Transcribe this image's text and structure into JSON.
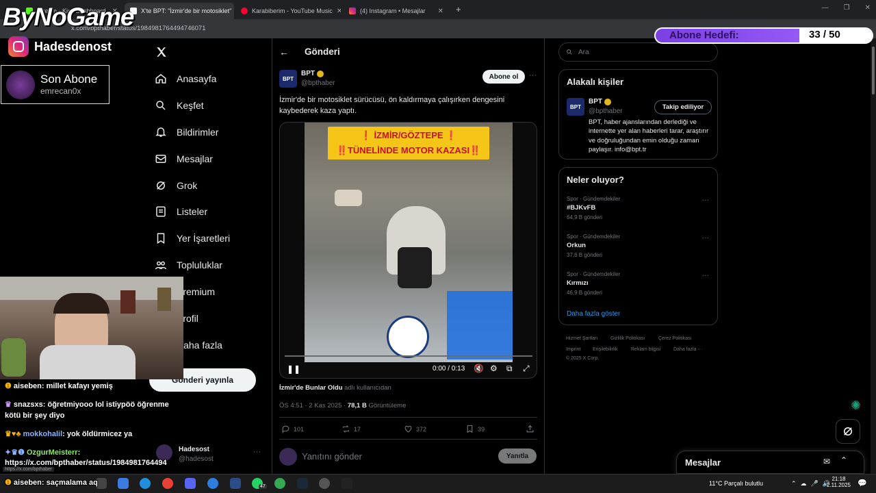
{
  "browser": {
    "tabs": [
      {
        "label": "Stream - Kick Dashboard"
      },
      {
        "label": "X'te BPT: \"İzmir'de bir motosiklet\""
      },
      {
        "label": "Karabiberim - YouTube Music"
      },
      {
        "label": "(4) Instagram • Mesajlar"
      }
    ],
    "url": "x.com/bpthaber/status/1984981764494746071"
  },
  "overlay": {
    "logo": "ByNoGame",
    "instagram_handle": "Hadesdenost",
    "last_sub_title": "Son Abone",
    "last_sub_name": "emrecan0x",
    "goal_label": "Abone Hedefi:",
    "goal_value": "33 / 50",
    "goal_progress": 0.66
  },
  "sidebar": {
    "items": [
      {
        "label": "Anasayfa",
        "icon": "home-icon"
      },
      {
        "label": "Keşfet",
        "icon": "search-icon"
      },
      {
        "label": "Bildirimler",
        "icon": "bell-icon"
      },
      {
        "label": "Mesajlar",
        "icon": "mail-icon"
      },
      {
        "label": "Grok",
        "icon": "grok-icon"
      },
      {
        "label": "Listeler",
        "icon": "list-icon"
      },
      {
        "label": "Yer İşaretleri",
        "icon": "bookmark-icon"
      },
      {
        "label": "Topluluklar",
        "icon": "communities-icon"
      },
      {
        "label": "Premium",
        "icon": "x-icon"
      },
      {
        "label": "Profil",
        "icon": "user-icon"
      },
      {
        "label": "Daha fazla",
        "icon": "more-icon"
      }
    ],
    "post_button": "Gönderi yayınla",
    "account_name": "Hadesost",
    "account_handle": "@hadesost"
  },
  "post": {
    "header": "Gönderi",
    "author_name": "BPT",
    "author_handle": "@bpthaber",
    "follow_label": "Abone ol",
    "text": "İzmir'de bir motosiklet sürücüsü, ön kaldırmaya çalışırken dengesini kaybederek kaza yaptı.",
    "video_banner_1": "❗ İZMİR/GÖZTEPE ❗",
    "video_banner_2": "‼️TÜNELİNDE MOTOR KAZASI‼️",
    "video_time": "0:00 / 0:13",
    "video_progress": 0.0,
    "source_name": "İzmir'de Bunlar Oldu",
    "source_suffix": "adlı kullanıcıdan",
    "timestamp": "ÖS 4:51 · 2 Kas 2025 · ",
    "views": "78,1 B",
    "views_label": "Görüntüleme",
    "replies": "101",
    "reposts": "17",
    "likes": "372",
    "bookmarks": "39",
    "reply_placeholder": "Yanıtını gönder",
    "reply_button": "Yanıtla"
  },
  "right": {
    "search_placeholder": "Ara",
    "related_title": "Alakalı kişiler",
    "related_name": "BPT",
    "related_handle": "@bpthaber",
    "related_follow": "Takip ediliyor",
    "related_bio": "BPT, haber ajanslarından derlediği ve internette yer alan haberleri tarar, araştırır ve doğruluğundan emin olduğu zaman paylaşır. info@bpt.tr",
    "trends_title": "Neler oluyor?",
    "trends": [
      {
        "category": "Spor · Gündemdekiler",
        "title": "#BJKvFB",
        "count": "64,9 B gönderi"
      },
      {
        "category": "Spor · Gündemdekiler",
        "title": "Orkun",
        "count": "37,6 B gönderi"
      },
      {
        "category": "Spor · Gündemdekiler",
        "title": "Kırmızı",
        "count": "46,9 B gönderi"
      }
    ],
    "show_more": "Daha fazla göster",
    "footer_links": [
      "Hizmet Şartları",
      "Gizlilik Politikası",
      "Çerez Politikası",
      "Imprint",
      "Erişilebilirlik",
      "Reklam bilgisi",
      "Daha fazla ···",
      "© 2025 X Corp."
    ]
  },
  "chat": [
    {
      "user": "aiseben",
      "msg": "millet kafayı yemiş",
      "color": "#ffffff"
    },
    {
      "user": "snazsxs",
      "msg": "öğretmiyooo lol istiypöö öğrenme",
      "color": "#d9b3ff"
    },
    {
      "user": "",
      "msg": "kötü bir şey diyo",
      "color": "#ffffff"
    },
    {
      "user": "mokkohalil",
      "msg": "yok öldürmicez ya",
      "color": "#8ab4ff"
    },
    {
      "user": "OzgurMeisterr",
      "msg": "",
      "color": "#8fe36f"
    },
    {
      "user": "",
      "msg": "https://x.com/bpthaber/status/1984981764494",
      "color": "#ffffff"
    },
    {
      "user": "aiseben",
      "msg": "saçmalama aq",
      "color": "#ffffff"
    }
  ],
  "status_link": "https://x.com/bpthaber",
  "messages_label": "Mesajlar",
  "taskbar": {
    "weather": "11°C  Parçalı bulutlu",
    "time": "21:18",
    "date": "2.11.2025",
    "badge": "47"
  },
  "colors": {
    "accent": "#1d9bf0",
    "background": "#000000",
    "border": "#2f3336",
    "muted": "#71767b"
  }
}
